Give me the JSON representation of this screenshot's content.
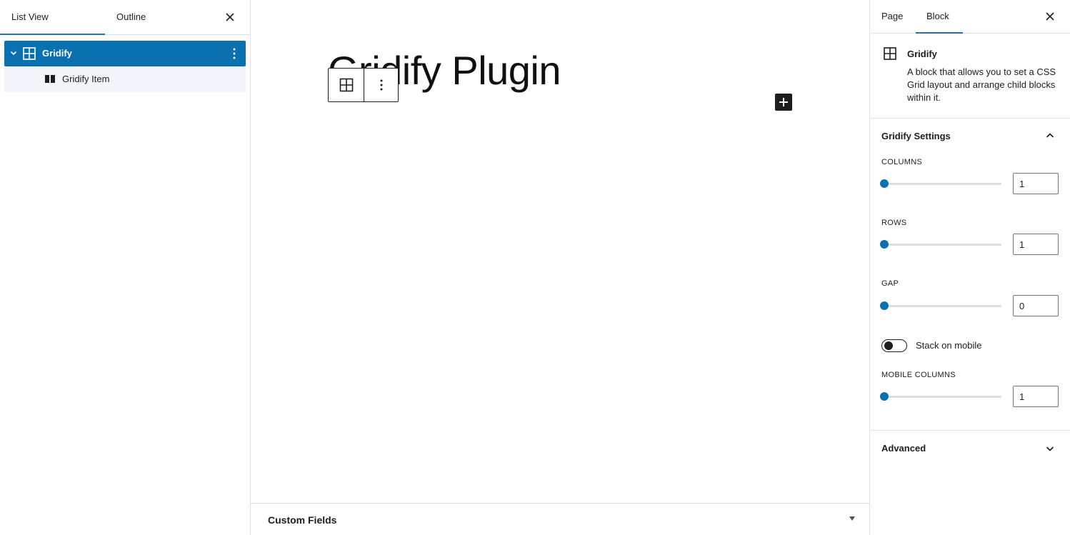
{
  "left_panel": {
    "tabs": [
      "List View",
      "Outline"
    ],
    "active_tab": "List View",
    "tree": {
      "root": {
        "label": "Gridify",
        "icon": "grid-icon",
        "expanded": true,
        "selected": true
      },
      "children": [
        {
          "label": "Gridify Item",
          "icon": "columns-icon"
        }
      ]
    }
  },
  "editor": {
    "title": "Gridify Plugin",
    "block_toolbar": {
      "icons": [
        "grid-icon",
        "more-vertical-icon"
      ]
    },
    "inserter_icon": "plus-icon",
    "meta_box": {
      "label": "Custom Fields",
      "icon": "triangle-down-icon"
    }
  },
  "right_panel": {
    "tabs": [
      "Page",
      "Block"
    ],
    "active_tab": "Block",
    "block_card": {
      "title": "Gridify",
      "description": "A block that allows you to set a CSS Grid layout and arrange child blocks within it."
    },
    "settings_panel": {
      "title": "Gridify Settings",
      "expanded": true,
      "columns": {
        "label": "COLUMNS",
        "value": "1",
        "fraction": 0
      },
      "rows": {
        "label": "ROWS",
        "value": "1",
        "fraction": 0
      },
      "gap": {
        "label": "GAP",
        "value": "0",
        "fraction": 0
      },
      "stack_toggle": {
        "label": "Stack on mobile",
        "checked": false
      },
      "mobile_columns": {
        "label": "MOBILE COLUMNS",
        "value": "1",
        "fraction": 0
      }
    },
    "advanced_panel": {
      "title": "Advanced",
      "expanded": false
    }
  },
  "colors": {
    "accent": "#0a71b0",
    "tab_underline": "#2271b1",
    "text": "#1e1e1e",
    "border": "#e0e0e0",
    "tree_child_bg": "#f2f6fa"
  }
}
